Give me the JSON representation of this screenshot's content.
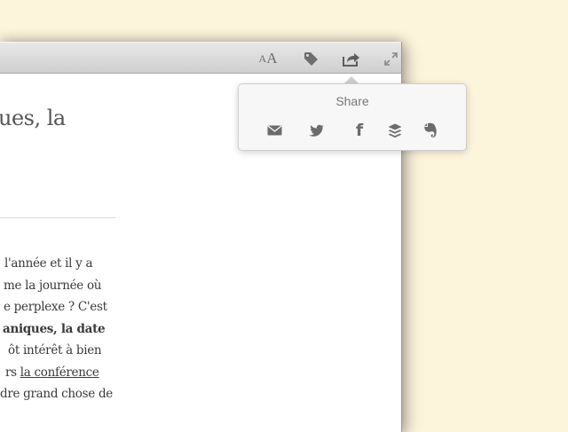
{
  "toolbar": {
    "font_small": "A",
    "font_big": "A"
  },
  "article": {
    "heading": "ues, la",
    "lines": [
      "l'année et il y a",
      "me la journée où",
      "e perplexe ? C'est",
      "aniques, la date",
      "ôt intérêt à bien",
      "rs ",
      "dre grand chose de"
    ],
    "link_text": "la conférence"
  },
  "share_popover": {
    "title": "Share",
    "items": [
      "mail-icon",
      "twitter-icon",
      "facebook-icon",
      "buffer-icon",
      "evernote-icon"
    ],
    "facebook_glyph": "f"
  },
  "colors": {
    "background": "#fdf4dc",
    "icon": "#6e6e6e"
  }
}
